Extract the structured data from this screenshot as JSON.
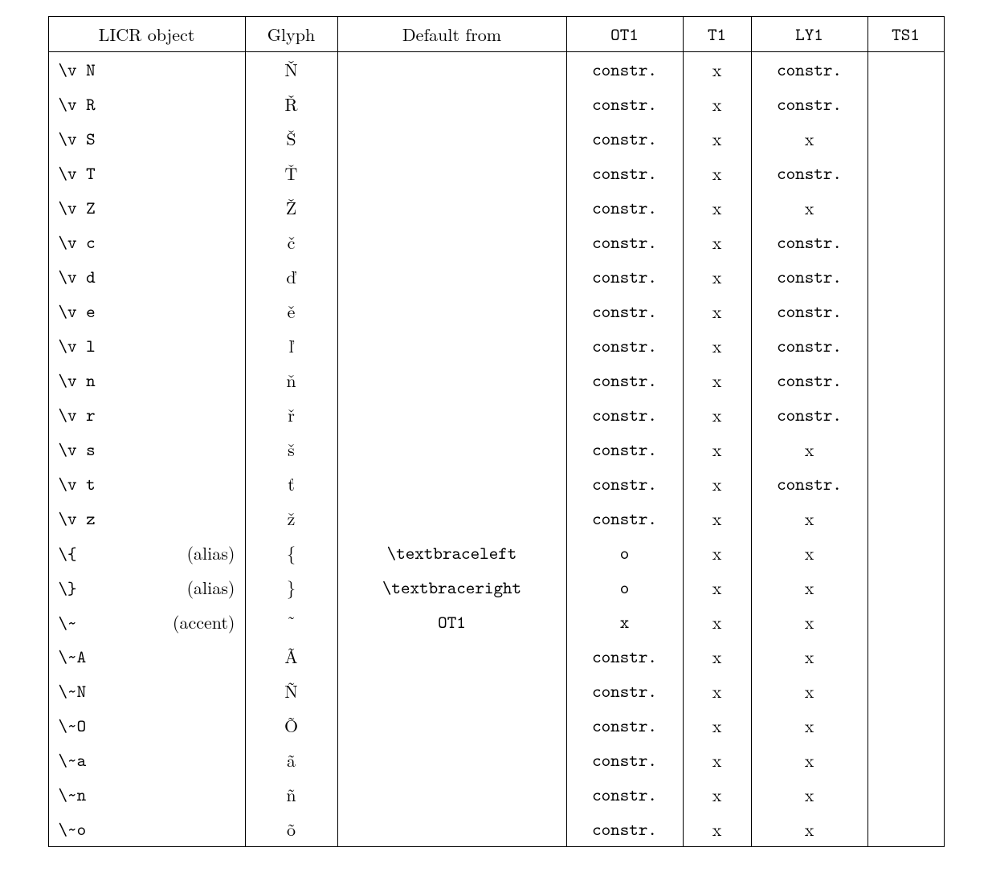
{
  "headers": {
    "licr": "LICR object",
    "glyph": "Glyph",
    "default": "Default from",
    "ot1": "OT1",
    "t1": "T1",
    "ly1": "LY1",
    "ts1": "TS1"
  },
  "rows": [
    {
      "licr": "\\v N",
      "note": "",
      "glyph": "Ň",
      "default": "",
      "ot1": "constr.",
      "t1": "x",
      "ly1": "constr.",
      "ts1": ""
    },
    {
      "licr": "\\v R",
      "note": "",
      "glyph": "Ř",
      "default": "",
      "ot1": "constr.",
      "t1": "x",
      "ly1": "constr.",
      "ts1": ""
    },
    {
      "licr": "\\v S",
      "note": "",
      "glyph": "Š",
      "default": "",
      "ot1": "constr.",
      "t1": "x",
      "ly1": "x",
      "ts1": ""
    },
    {
      "licr": "\\v T",
      "note": "",
      "glyph": "Ť",
      "default": "",
      "ot1": "constr.",
      "t1": "x",
      "ly1": "constr.",
      "ts1": ""
    },
    {
      "licr": "\\v Z",
      "note": "",
      "glyph": "Ž",
      "default": "",
      "ot1": "constr.",
      "t1": "x",
      "ly1": "x",
      "ts1": ""
    },
    {
      "licr": "\\v c",
      "note": "",
      "glyph": "č",
      "default": "",
      "ot1": "constr.",
      "t1": "x",
      "ly1": "constr.",
      "ts1": ""
    },
    {
      "licr": "\\v d",
      "note": "",
      "glyph": "ď",
      "default": "",
      "ot1": "constr.",
      "t1": "x",
      "ly1": "constr.",
      "ts1": ""
    },
    {
      "licr": "\\v e",
      "note": "",
      "glyph": "ě",
      "default": "",
      "ot1": "constr.",
      "t1": "x",
      "ly1": "constr.",
      "ts1": ""
    },
    {
      "licr": "\\v l",
      "note": "",
      "glyph": "ľ",
      "default": "",
      "ot1": "constr.",
      "t1": "x",
      "ly1": "constr.",
      "ts1": ""
    },
    {
      "licr": "\\v n",
      "note": "",
      "glyph": "ň",
      "default": "",
      "ot1": "constr.",
      "t1": "x",
      "ly1": "constr.",
      "ts1": ""
    },
    {
      "licr": "\\v r",
      "note": "",
      "glyph": "ř",
      "default": "",
      "ot1": "constr.",
      "t1": "x",
      "ly1": "constr.",
      "ts1": ""
    },
    {
      "licr": "\\v s",
      "note": "",
      "glyph": "š",
      "default": "",
      "ot1": "constr.",
      "t1": "x",
      "ly1": "x",
      "ts1": ""
    },
    {
      "licr": "\\v t",
      "note": "",
      "glyph": "ť",
      "default": "",
      "ot1": "constr.",
      "t1": "x",
      "ly1": "constr.",
      "ts1": ""
    },
    {
      "licr": "\\v z",
      "note": "",
      "glyph": "ž",
      "default": "",
      "ot1": "constr.",
      "t1": "x",
      "ly1": "x",
      "ts1": ""
    },
    {
      "licr": "\\{",
      "note": "(alias)",
      "glyph": "{",
      "default": "\\textbraceleft",
      "default_mono": true,
      "ot1": "o",
      "t1": "x",
      "ly1": "x",
      "ts1": ""
    },
    {
      "licr": "\\}",
      "note": "(alias)",
      "glyph": "}",
      "default": "\\textbraceright",
      "default_mono": true,
      "ot1": "o",
      "t1": "x",
      "ly1": "x",
      "ts1": ""
    },
    {
      "licr": "\\~",
      "note": "(accent)",
      "glyph": "˜",
      "default": "OT1",
      "default_mono": true,
      "ot1": "x",
      "t1": "x",
      "ly1": "x",
      "ts1": ""
    },
    {
      "licr": "\\~A",
      "note": "",
      "glyph": "Ã",
      "default": "",
      "ot1": "constr.",
      "t1": "x",
      "ly1": "x",
      "ts1": ""
    },
    {
      "licr": "\\~N",
      "note": "",
      "glyph": "Ñ",
      "default": "",
      "ot1": "constr.",
      "t1": "x",
      "ly1": "x",
      "ts1": ""
    },
    {
      "licr": "\\~O",
      "note": "",
      "glyph": "Õ",
      "default": "",
      "ot1": "constr.",
      "t1": "x",
      "ly1": "x",
      "ts1": ""
    },
    {
      "licr": "\\~a",
      "note": "",
      "glyph": "ã",
      "default": "",
      "ot1": "constr.",
      "t1": "x",
      "ly1": "x",
      "ts1": ""
    },
    {
      "licr": "\\~n",
      "note": "",
      "glyph": "ñ",
      "default": "",
      "ot1": "constr.",
      "t1": "x",
      "ly1": "x",
      "ts1": ""
    },
    {
      "licr": "\\~o",
      "note": "",
      "glyph": "õ",
      "default": "",
      "ot1": "constr.",
      "t1": "x",
      "ly1": "x",
      "ts1": ""
    }
  ]
}
